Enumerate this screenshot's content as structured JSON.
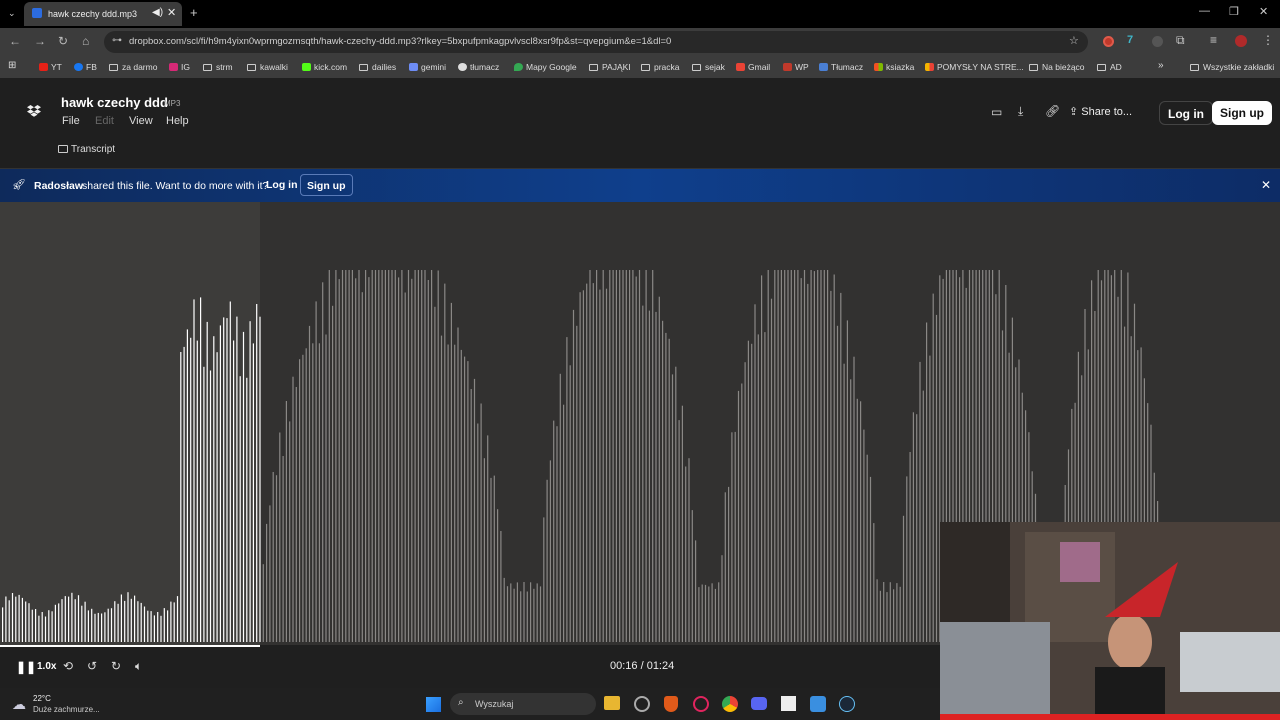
{
  "browser": {
    "tab_title": "hawk czechy ddd.mp3",
    "url": "dropbox.com/scl/fi/h9m4yixn0wprmgozmsqth/hawk-czechy-ddd.mp3?rlkey=5bxpufpmkagpvlvscl8xsr9fp&st=qvepgium&e=1&dl=0",
    "bookmarks": [
      "YT",
      "FB",
      "za darmo",
      "IG",
      "strm",
      "kawalki",
      "kick.com",
      "dailies",
      "gemini",
      "tłumacz",
      "Mapy Google",
      "PAJĄKI",
      "pracka",
      "sejak",
      "Gmail",
      "WP",
      "Tłumacz",
      "ksiazka",
      "POMYSŁY NA STRE...",
      "Na bieżąco",
      "AD"
    ],
    "all_bookmarks": "Wszystkie zakładki"
  },
  "file": {
    "name": "hawk czechy ddd",
    "type": "MP3",
    "menu": [
      "File",
      "Edit",
      "View",
      "Help"
    ],
    "transcript": "Transcript",
    "share": "Share to...",
    "login": "Log in",
    "signup": "Sign up"
  },
  "banner": {
    "sharer": "Radosław",
    "message": "shared this file. Want to do more with it?",
    "login": "Log in",
    "signup": "Sign up"
  },
  "player": {
    "speed": "1.0x",
    "time": "00:16 / 01:24",
    "progress": 0.203
  },
  "taskbar": {
    "temp": "22°C",
    "weather": "Duże zachmurze...",
    "search": "Wyszukaj"
  },
  "colors": {
    "accent": "#0f3f8c",
    "waveform": "#8a8886",
    "played": "#ffffff"
  }
}
